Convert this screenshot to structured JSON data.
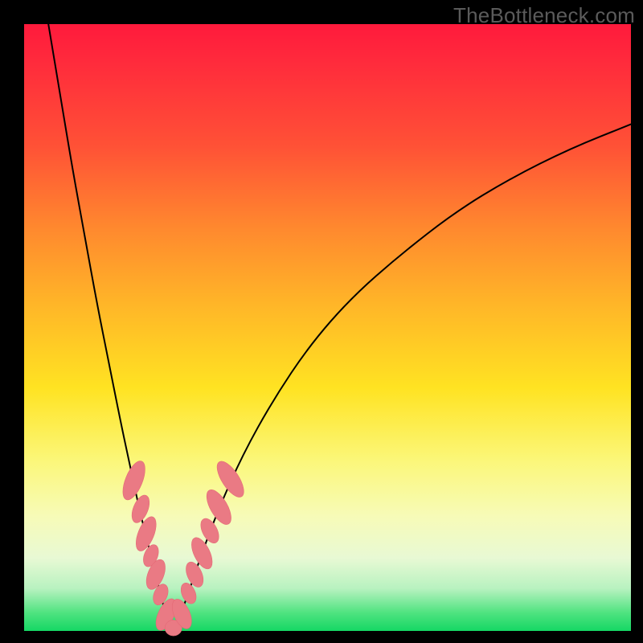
{
  "watermark": "TheBottleneck.com",
  "colors": {
    "frame": "#000000",
    "curve": "#000000",
    "marker_fill": "#ea7a84",
    "marker_stroke": "#e46a76",
    "gradient_top": "#ff1a3c",
    "gradient_bottom": "#15d764"
  },
  "chart_data": {
    "type": "line",
    "title": "",
    "xlabel": "",
    "ylabel": "",
    "xlim": [
      0,
      100
    ],
    "ylim": [
      0,
      100
    ],
    "grid": false,
    "legend": false,
    "series": [
      {
        "name": "left-branch",
        "x": [
          4,
          6,
          8,
          10,
          12,
          14,
          16,
          17.5,
          19,
          20.5,
          22,
          23,
          23.8,
          24.5
        ],
        "y": [
          100,
          88,
          76,
          65,
          54,
          44,
          34,
          27,
          20,
          14,
          8,
          4,
          1.2,
          0
        ]
      },
      {
        "name": "right-branch",
        "x": [
          24.5,
          25.5,
          27,
          29,
          32,
          36,
          41,
          47,
          54,
          62,
          71,
          80,
          90,
          100
        ],
        "y": [
          0,
          2,
          6,
          12,
          20,
          29,
          38,
          47,
          55,
          62,
          69,
          74.5,
          79.5,
          83.5
        ]
      }
    ],
    "markers": {
      "name": "beads",
      "points": [
        {
          "x": 18.1,
          "y": 24.8,
          "rx": 1.4,
          "ry": 3.4,
          "rot": 22
        },
        {
          "x": 19.2,
          "y": 20.1,
          "rx": 1.2,
          "ry": 2.4,
          "rot": 22
        },
        {
          "x": 20.1,
          "y": 16.0,
          "rx": 1.3,
          "ry": 3.0,
          "rot": 22
        },
        {
          "x": 20.9,
          "y": 12.4,
          "rx": 1.1,
          "ry": 1.9,
          "rot": 22
        },
        {
          "x": 21.7,
          "y": 9.3,
          "rx": 1.3,
          "ry": 2.6,
          "rot": 22
        },
        {
          "x": 22.5,
          "y": 6.0,
          "rx": 1.1,
          "ry": 1.8,
          "rot": 22
        },
        {
          "x": 23.4,
          "y": 2.7,
          "rx": 1.3,
          "ry": 2.8,
          "rot": 25
        },
        {
          "x": 24.6,
          "y": 0.5,
          "rx": 1.4,
          "ry": 1.3,
          "rot": 0
        },
        {
          "x": 26.0,
          "y": 2.8,
          "rx": 1.3,
          "ry": 2.6,
          "rot": -24
        },
        {
          "x": 27.1,
          "y": 6.2,
          "rx": 1.1,
          "ry": 1.8,
          "rot": -24
        },
        {
          "x": 28.1,
          "y": 9.3,
          "rx": 1.2,
          "ry": 2.2,
          "rot": -24
        },
        {
          "x": 29.3,
          "y": 12.8,
          "rx": 1.3,
          "ry": 2.8,
          "rot": -26
        },
        {
          "x": 30.6,
          "y": 16.5,
          "rx": 1.2,
          "ry": 2.2,
          "rot": -28
        },
        {
          "x": 32.1,
          "y": 20.4,
          "rx": 1.4,
          "ry": 3.2,
          "rot": -30
        },
        {
          "x": 34.0,
          "y": 25.0,
          "rx": 1.4,
          "ry": 3.4,
          "rot": -33
        }
      ]
    }
  }
}
